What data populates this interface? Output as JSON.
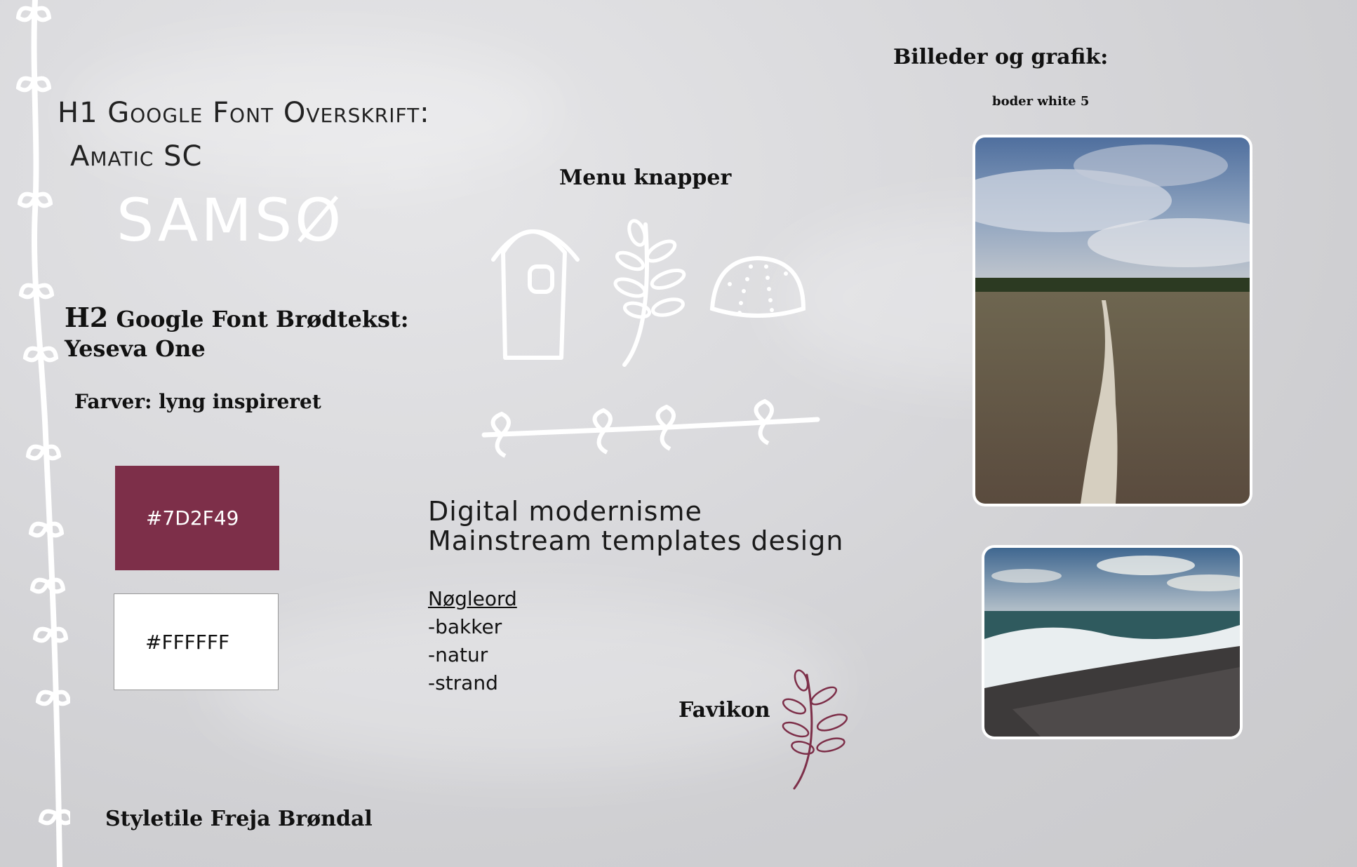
{
  "header": {
    "images_title": "Billeder og grafik:",
    "border_caption": "boder white 5"
  },
  "typography": {
    "h1_label": "H1 Google Font Overskrift:",
    "h1_font_name": "Amatic SC",
    "sample_word": "Samsø",
    "h2_prefix": "H2",
    "h2_label": "Google Font Brødtekst:",
    "h2_font_name": "Yeseva One"
  },
  "colors": {
    "title": "Farver: lyng inspireret",
    "swatches": [
      {
        "label": "#7D2F49",
        "hex": "#7D2F49"
      },
      {
        "label": "#FFFFFF",
        "hex": "#FFFFFF"
      }
    ]
  },
  "menu": {
    "title": "Menu knapper",
    "icons": [
      "hut-icon",
      "leaf-sprig-icon",
      "shell-icon",
      "vine-divider-icon"
    ]
  },
  "style": {
    "line1": "Digital modernisme",
    "line2": "Mainstream templates design"
  },
  "keywords": {
    "title": "Nøgleord",
    "items": [
      "-bakker",
      "-natur",
      "-strand"
    ]
  },
  "favicon": {
    "label": "Favikon",
    "icon": "leaf-sprig-icon",
    "color": "#7D2F49"
  },
  "footer": {
    "credit": "Styletile Freja Brøndal"
  },
  "photos": [
    {
      "name": "heath-path-photo",
      "description": "Heathland path"
    },
    {
      "name": "beach-waves-photo",
      "description": "Waves on pebble beach"
    }
  ]
}
